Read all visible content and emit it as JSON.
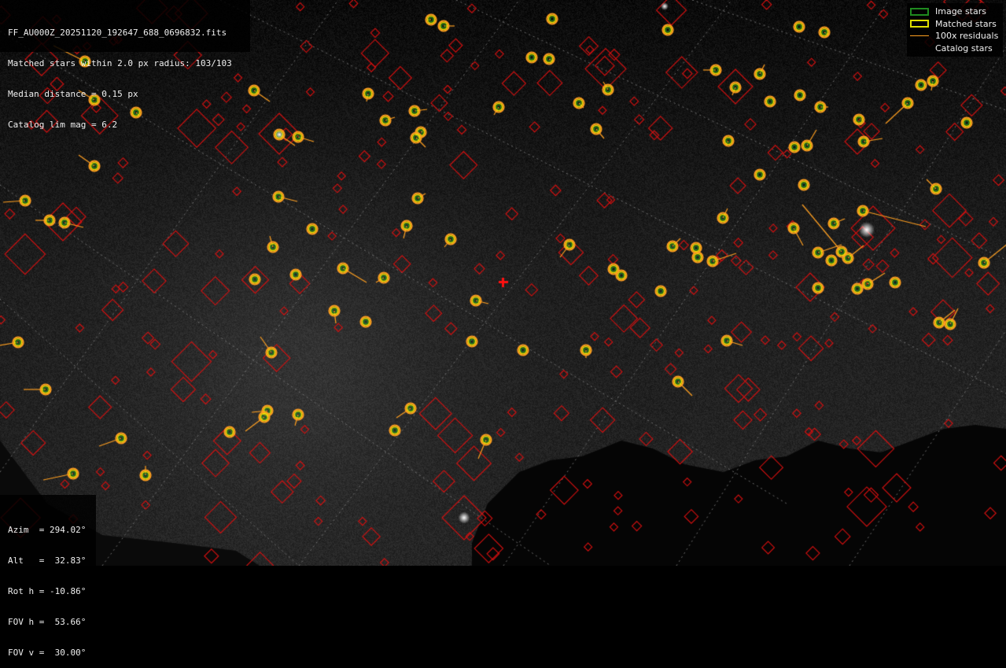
{
  "header": {
    "filename": "FF_AU000Z_20251120_192647_688_0696832.fits",
    "matched": "Matched stars within 2.0 px radius: 103/103",
    "median": "Median distance = 0.15 px",
    "catalog_lim": "Catalog lim mag = 6.2"
  },
  "legend": {
    "image_stars": "Image stars",
    "matched_stars": "Matched stars",
    "residuals": "100x residuals",
    "catalog_stars": "Catalog stars"
  },
  "pointing": {
    "azim": "Azim  = 294.02°",
    "alt": "Alt   =  32.83°",
    "rot": "Rot h = -10.86°",
    "fovh": "FOV h =  53.66°",
    "fovv": "FOV v =  30.00°"
  },
  "colors": {
    "catalog": "#d81010",
    "matched_ring": "#e8e800",
    "image_ring": "#1f8a1f",
    "residual": "#ff9f20",
    "center_marker": "#ff1010",
    "grid": "#8a8a8a"
  }
}
